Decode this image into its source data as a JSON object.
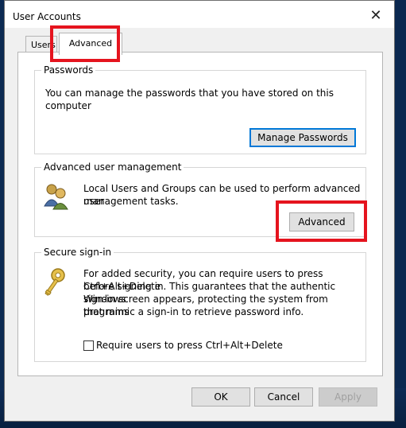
{
  "window": {
    "title": "User Accounts"
  },
  "tabs": [
    {
      "label": "Users"
    },
    {
      "label": "Advanced"
    }
  ],
  "passwords": {
    "label": "Passwords",
    "description": "You can manage the passwords that you have stored on this computer",
    "button": "Manage Passwords"
  },
  "advanced_management": {
    "label": "Advanced user management",
    "description_line1": "Local Users and Groups can be used to perform advanced user",
    "description_line2": "management tasks.",
    "button": "Advanced"
  },
  "secure_signin": {
    "label": "Secure sign-in",
    "line1": "For added security, you can require users to press Ctrl+Alt+Delete",
    "line2": "before signing in. This guarantees that the authentic Windows",
    "line3": "sign-in screen appears, protecting the system from programs",
    "line4": "that mimic a sign-in to retrieve password info.",
    "checkbox_label": "Require users to press Ctrl+Alt+Delete"
  },
  "footer": {
    "ok": "OK",
    "cancel": "Cancel",
    "apply": "Apply"
  },
  "colors": {
    "highlight": "#e5141e",
    "focus": "#0078d7"
  }
}
